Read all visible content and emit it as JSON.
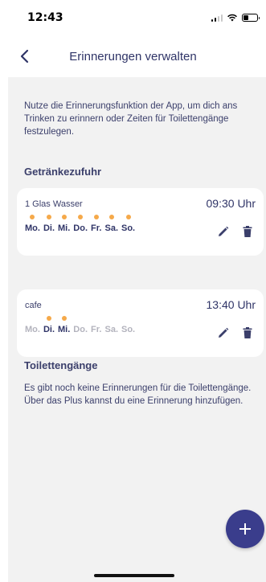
{
  "status_bar": {
    "time": "12:43"
  },
  "header": {
    "title": "Erinnerungen verwalten",
    "back_icon": "chevron-left-icon"
  },
  "intro_text": "Nutze die Erinnerungsfunktion der App, um dich ans Trinken zu erinnern oder Zeiten für Toilettengänge festzulegen.",
  "drinks": {
    "title": "Getränkezufuhr",
    "reminders": [
      {
        "name": "1 Glas Wasser",
        "time": "09:30 Uhr",
        "days": [
          {
            "label": "Mo.",
            "active": true
          },
          {
            "label": "Di.",
            "active": true
          },
          {
            "label": "Mi.",
            "active": true
          },
          {
            "label": "Do.",
            "active": true
          },
          {
            "label": "Fr.",
            "active": true
          },
          {
            "label": "Sa.",
            "active": true
          },
          {
            "label": "So.",
            "active": true
          }
        ]
      },
      {
        "name": "cafe",
        "time": "13:40 Uhr",
        "days": [
          {
            "label": "Mo.",
            "active": false
          },
          {
            "label": "Di.",
            "active": true
          },
          {
            "label": "Mi.",
            "active": true
          },
          {
            "label": "Do.",
            "active": false
          },
          {
            "label": "Fr.",
            "active": false
          },
          {
            "label": "Sa.",
            "active": false
          },
          {
            "label": "So.",
            "active": false
          }
        ]
      }
    ]
  },
  "toilet": {
    "title": "Toilettengänge",
    "empty_text": "Es gibt noch keine Erinnerungen für die Toilettengänge. Über das Plus kannst du eine Erinnerung hinzufügen."
  },
  "colors": {
    "accent": "#3a3d8c",
    "dot": "#f5a94a",
    "text": "#3b3f6b",
    "background": "#f2f2f2"
  },
  "icons": [
    "edit-icon",
    "trash-icon",
    "plus-icon"
  ]
}
